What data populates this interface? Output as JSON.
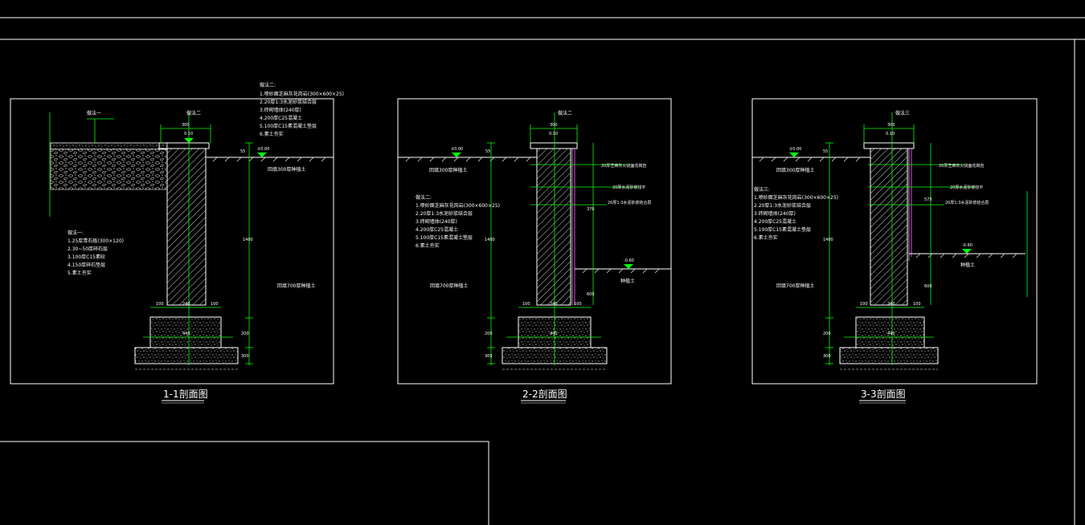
{
  "colors": {
    "background": "#000000",
    "frame": "#ffffff",
    "dimension": "#00ff00",
    "finish": "#cc33cc",
    "text": "#ffffff"
  },
  "sections": [
    {
      "title": "1-1剖面图",
      "callout_a": "做法一",
      "callout_b": "做法二",
      "elev_top": "0.10",
      "elev_ground": "±0.00",
      "note_a_lines": [
        "做法二:",
        "1.喷砂面芝麻灰花岗岩(300×600×25)",
        "2.20厚1:3水泥砂浆结合层",
        "3.砖砌墙体(240厚)",
        "4.200厚C25混凝土",
        "5.100厚C15素混凝土垫层",
        "6.素土夯实"
      ],
      "note_b_lines": [
        "做法一:",
        "1.25厚青石板(300×120)",
        "2.30~50厚碎石层",
        "3.100厚C15素砼",
        "4.150厚碎石垫层",
        "5.素土夯实"
      ],
      "soil_a": "回填300厚种植土",
      "soil_b": "回填700厚种植土",
      "dims": [
        "300",
        "55",
        "1400",
        "100",
        "240",
        "100",
        "440",
        "200",
        "300"
      ]
    },
    {
      "title": "2-2剖面图",
      "callout_a": "做法二",
      "elev_top": "0.10",
      "elev_ground": "±0.00",
      "elev_low": "-0.60",
      "note_a_lines": [
        "做法二:",
        "1.喷砂面芝麻灰花岗岩(300×600×25)",
        "2.20厚1:3水泥砂浆结合层",
        "3.砖砌墙体(240厚)",
        "4.200厚C25混凝土",
        "5.100厚C15素混凝土垫层",
        "6.素土夯实"
      ],
      "soil_a": "回填300厚种植土",
      "soil_b": "回填700厚种植土",
      "soil_c": "种植土",
      "finish_lines": [
        "20厚芝麻灰火烧面花岗岩",
        "20厚水泥砂浆找平",
        "20厚1:3水泥砂浆结合层"
      ],
      "dims": [
        "300",
        "55",
        "1400",
        "100",
        "240",
        "100",
        "440",
        "200",
        "300",
        "370",
        "600"
      ]
    },
    {
      "title": "3-3剖面图",
      "callout_a": "做法三",
      "elev_top": "0.10",
      "elev_ground": "±0.00",
      "elev_low": "-0.60",
      "note_a_lines": [
        "做法三:",
        "1.喷砂面芝麻灰花岗岩(300×600×25)",
        "2.20厚1:3水泥砂浆结合层",
        "3.砖砌墙体(240厚)",
        "4.200厚C25混凝土",
        "5.100厚C15素混凝土垫层",
        "6.素土夯实"
      ],
      "soil_a": "回填300厚种植土",
      "soil_b": "回填700厚种植土",
      "soil_c": "种植土",
      "finish_lines": [
        "20厚芝麻灰火烧面花岗岩",
        "20厚水泥砂浆找平",
        "20厚1:3水泥砂浆结合层"
      ],
      "dims": [
        "300",
        "55",
        "1400",
        "100",
        "240",
        "100",
        "440",
        "200",
        "300",
        "575",
        "600"
      ]
    }
  ]
}
